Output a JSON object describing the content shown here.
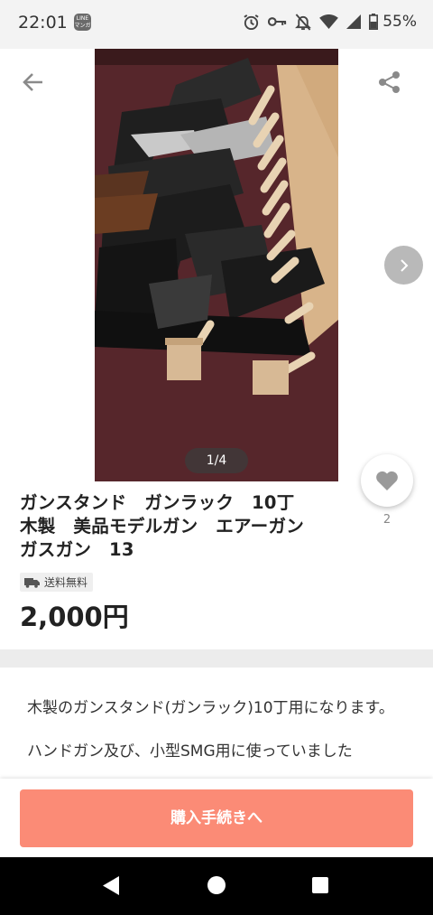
{
  "status_bar": {
    "time": "22:01",
    "line_icon_label": "LINE\nマンガ",
    "battery": "55%",
    "icons": [
      "line-manga-icon",
      "alarm-icon",
      "key-icon",
      "bell-off-icon",
      "wifi-icon",
      "signal-icon",
      "battery-icon"
    ]
  },
  "header": {
    "back_icon": "arrow-left-icon",
    "share_icon": "share-icon"
  },
  "gallery": {
    "counter": "1/4",
    "next_icon": "chevron-right-icon"
  },
  "like": {
    "icon": "heart-icon",
    "count": "2"
  },
  "product": {
    "title": "ガンスタンド　ガンラック　10丁\n木製　美品モデルガン　エアーガン\nガスガン　13",
    "shipping_label": "送料無料",
    "shipping_icon": "truck-icon",
    "price": "2,000円"
  },
  "description": {
    "paragraphs": [
      "木製のガンスタンド(ガンラック)10丁用になります。",
      "ハンドガン及び、小型SMG用に使っていました"
    ]
  },
  "purchase": {
    "button_label": "購入手続きへ"
  },
  "colors": {
    "accent": "#fb8b76",
    "divider": "#ececec"
  }
}
